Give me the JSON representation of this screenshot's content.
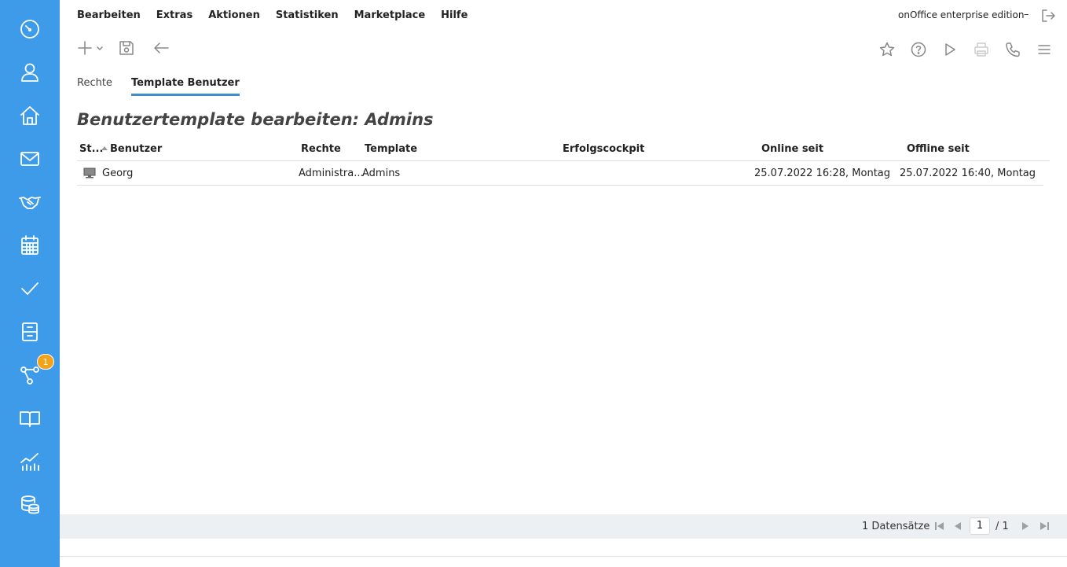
{
  "menu": {
    "items": [
      "Bearbeiten",
      "Extras",
      "Aktionen",
      "Statistiken",
      "Marketplace",
      "Hilfe"
    ],
    "edition": "onOffice enterprise edition",
    "minus": "–"
  },
  "sidebar": {
    "icons": [
      "dashboard-icon",
      "person-icon",
      "home-icon",
      "mail-icon",
      "handshake-icon",
      "calendar-icon",
      "check-icon",
      "filing-cabinet-icon",
      "workflow-icon",
      "book-icon",
      "statistics-icon",
      "database-icon"
    ],
    "badge": "1"
  },
  "toolbar": {
    "left": [
      "plus-icon",
      "save-icon",
      "back-arrow-icon"
    ],
    "right": [
      "star-icon",
      "help-icon",
      "play-icon",
      "print-icon",
      "phone-icon",
      "hamburger-menu-icon"
    ]
  },
  "tabs": [
    {
      "label": "Rechte",
      "active": false
    },
    {
      "label": "Template Benutzer",
      "active": true
    }
  ],
  "page_title": "Benutzertemplate bearbeiten: Admins",
  "table": {
    "headers": {
      "status": "St...",
      "benutzer": "Benutzer",
      "rechte": "Rechte",
      "template": "Template",
      "erfolgscockpit": "Erfolgscockpit",
      "online": "Online seit",
      "offline": "Offline seit"
    },
    "rows": [
      {
        "status_icon": "monitor-icon",
        "benutzer": "Georg",
        "rechte": "Administra...",
        "template": "Admins",
        "erfolgscockpit": "",
        "online": "25.07.2022 16:28, Montag",
        "offline": "25.07.2022 16:40, Montag"
      }
    ]
  },
  "footer": {
    "count": "1 Datensätze",
    "page": "1",
    "total": "/ 1"
  }
}
